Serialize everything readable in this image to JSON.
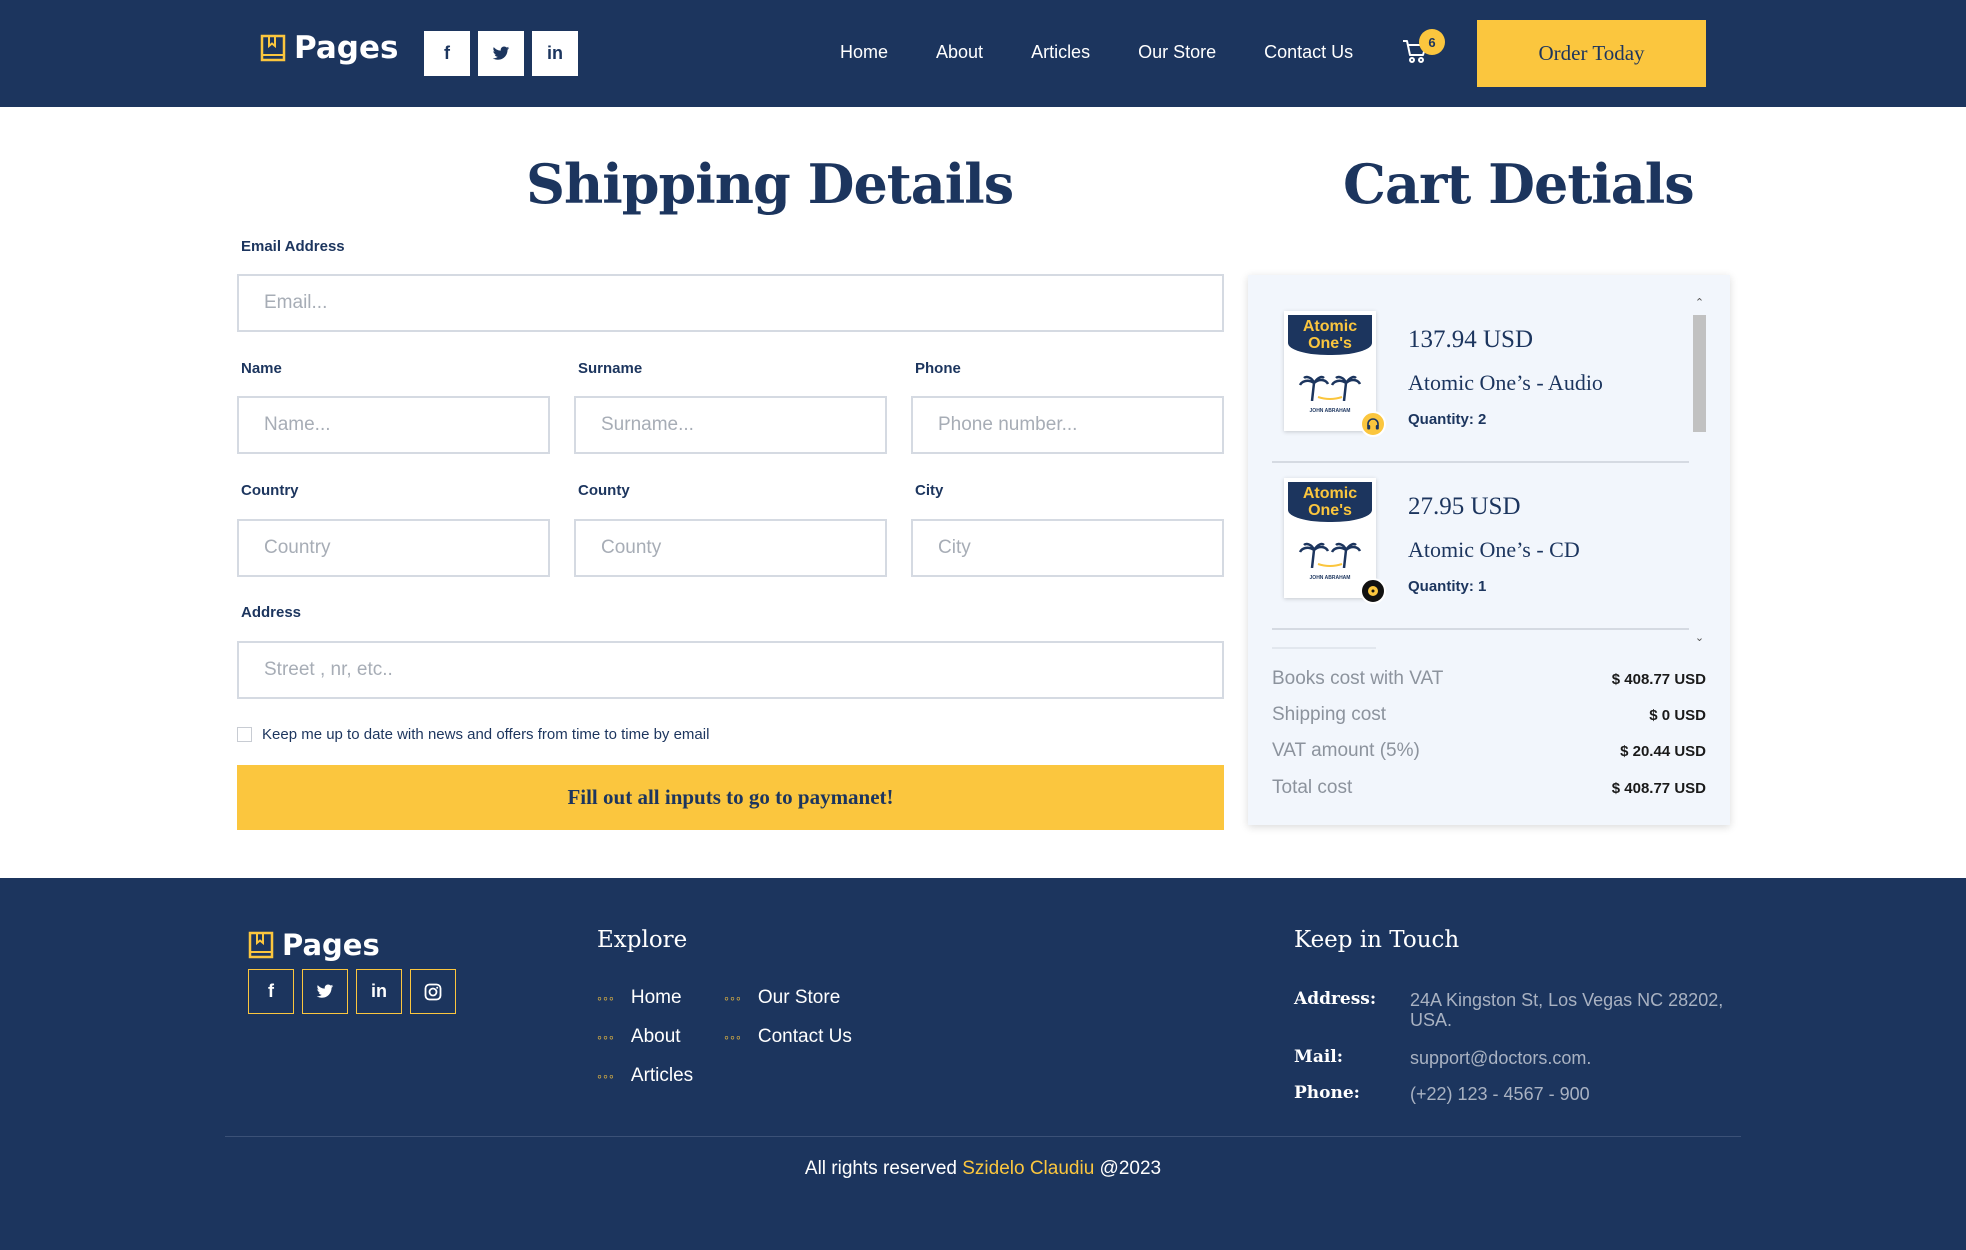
{
  "brand": {
    "name": "Pages"
  },
  "header": {
    "social": [
      "f",
      "t",
      "in"
    ],
    "nav": [
      "Home",
      "About",
      "Articles",
      "Our Store",
      "Contact Us"
    ],
    "cart_count": "6",
    "order_label": "Order Today"
  },
  "shipping": {
    "title": "Shipping Details",
    "email_label": "Email Address",
    "email_placeholder": "Email...",
    "name_label": "Name",
    "name_placeholder": "Name...",
    "surname_label": "Surname",
    "surname_placeholder": "Surname...",
    "phone_label": "Phone",
    "phone_placeholder": "Phone number...",
    "country_label": "Country",
    "country_placeholder": "Country",
    "county_label": "County",
    "county_placeholder": "County",
    "city_label": "City",
    "city_placeholder": "City",
    "address_label": "Address",
    "address_placeholder": "Street , nr, etc..",
    "newsletter_label": "Keep me up to date with news and offers from time to time by email",
    "submit_label": "Fill out all inputs to go to paymanet!"
  },
  "cart": {
    "title": "Cart Detials",
    "book_cover_title": "Atomic One's",
    "book_author": "JOHN ABRAHAM",
    "items": [
      {
        "price": "137.94 USD",
        "name": "Atomic One’s - Audio",
        "quantity": "Quantity: 2",
        "badge_icon": "headphones-icon"
      },
      {
        "price": "27.95 USD",
        "name": "Atomic One’s - CD",
        "quantity": "Quantity: 1",
        "badge_icon": "disc-icon"
      }
    ],
    "costs": [
      {
        "label": "Books cost with VAT",
        "value": "$ 408.77 USD"
      },
      {
        "label": "Shipping cost",
        "value": "$ 0 USD"
      },
      {
        "label": "VAT amount (5%)",
        "value": "$ 20.44 USD"
      },
      {
        "label": "Total cost",
        "value": "$ 408.77 USD"
      }
    ]
  },
  "footer": {
    "social": [
      "f",
      "t",
      "in",
      "ig"
    ],
    "explore_title": "Explore",
    "explore_links": [
      "Home",
      "Our Store",
      "About",
      "Contact Us",
      "Articles"
    ],
    "touch_title": "Keep in Touch",
    "address_label": "Address:",
    "address_value": "24A Kingston St, Los Vegas NC 28202, USA.",
    "mail_label": "Mail:",
    "mail_value": "support@doctors.com.",
    "phone_label": "Phone:",
    "phone_value": "(+22) 123 - 4567 - 900",
    "copyright_prefix": "All rights reserved",
    "copyright_name": "Szidelo Claudiu",
    "copyright_suffix": "@2023"
  },
  "colors": {
    "navy": "#1c355e",
    "accent": "#fbc63e",
    "panel": "#f2f6fc"
  }
}
